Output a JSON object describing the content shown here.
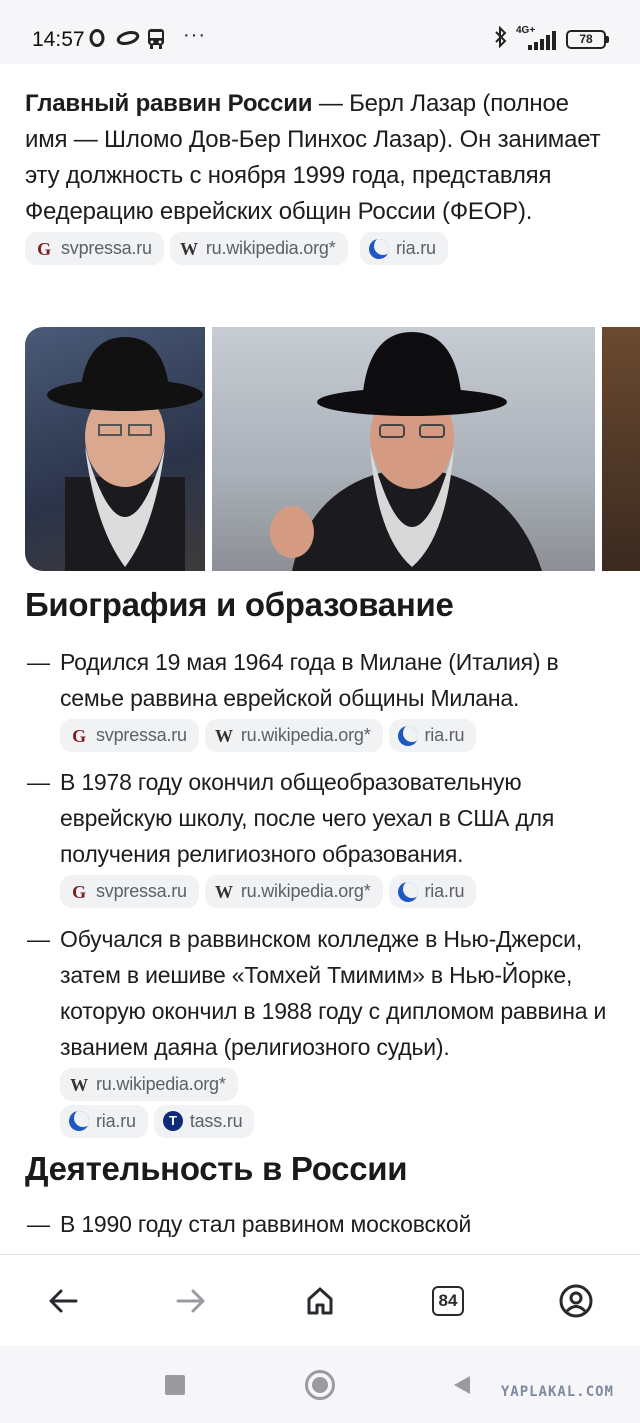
{
  "status_bar": {
    "time": "14:57",
    "network": "4G+",
    "battery": "78",
    "more": "···"
  },
  "intro": {
    "bold": "Главный раввин России",
    "text": " — Берл Лазар (полное имя — Шломо Дов-Бер Пинхос Лазар). Он занимает эту должность с ноября 1999 года, представляя Федерацию еврейских общин России (ФЕОР).",
    "sources": [
      "svpressa.ru",
      "ru.wikipedia.org*",
      "ria.ru"
    ]
  },
  "sections": [
    {
      "title": "Биография и образование",
      "items": [
        {
          "text": "Родился 19 мая 1964 года в Милане (Италия) в семье раввина еврейской общины Милана.",
          "sources": [
            "svpressa.ru",
            "ru.wikipedia.org*",
            "ria.ru"
          ]
        },
        {
          "text": "В 1978 году окончил общеобразовательную еврейскую школу, после чего уехал в США для получения религиозного образования.",
          "sources": [
            "svpressa.ru",
            "ru.wikipedia.org*",
            "ria.ru"
          ]
        },
        {
          "text": "Обучался в раввинском колледже в Нью-Джерси, затем в иешиве «Томхей Тмимим» в Нью-Йорке, которую окончил в 1988 году с дипломом раввина и званием даяна (религиозного судьи).",
          "sources": [
            "ru.wikipedia.org*",
            "ria.ru",
            "tass.ru"
          ]
        }
      ]
    },
    {
      "title": "Деятельность в России",
      "items": [
        {
          "text": "В 1990 году стал раввином московской"
        }
      ]
    }
  ],
  "bottom_nav": {
    "tabs_count": "84",
    "items": [
      "back-icon",
      "forward-icon",
      "home-icon",
      "tabs-icon",
      "profile-icon"
    ]
  },
  "android_nav": [
    "recents-icon",
    "home-circle-icon",
    "back-triangle-icon"
  ],
  "watermark": "YAPLAKAL.COM",
  "colors": {
    "text": "#1d1d1f",
    "chip_bg": "#f1f2f4",
    "chip_text": "#5e6067",
    "ria_blue": "#1d57c4",
    "tass_blue": "#0d2b7a"
  }
}
